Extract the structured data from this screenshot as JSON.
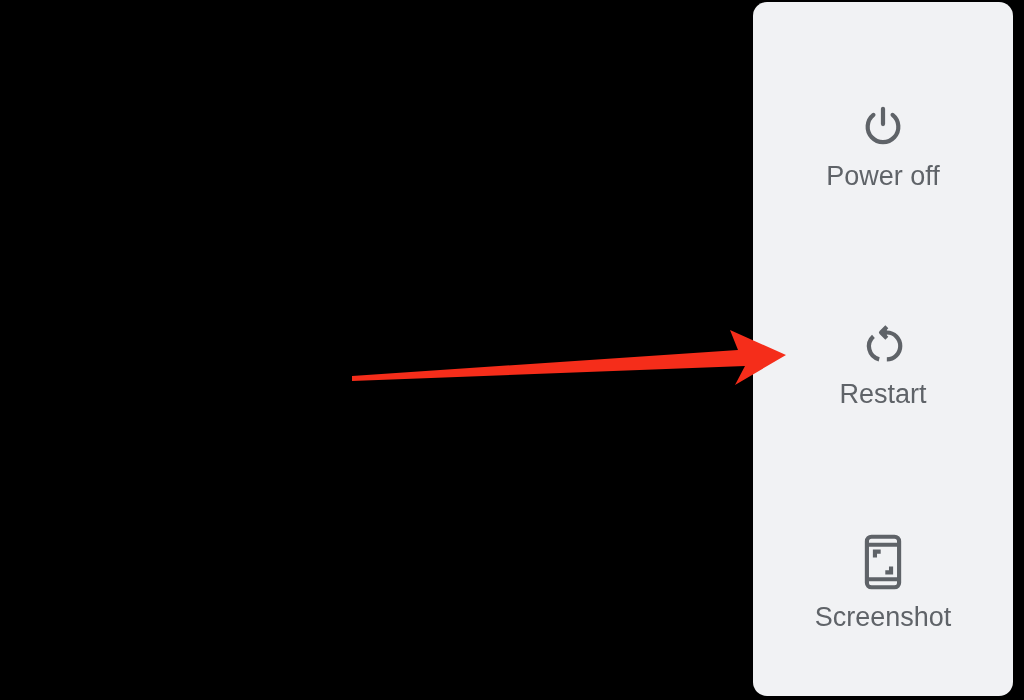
{
  "power_menu": {
    "items": [
      {
        "kind": "power",
        "label": "Power off"
      },
      {
        "kind": "restart",
        "label": "Restart"
      },
      {
        "kind": "screenshot",
        "label": "Screenshot"
      }
    ]
  }
}
